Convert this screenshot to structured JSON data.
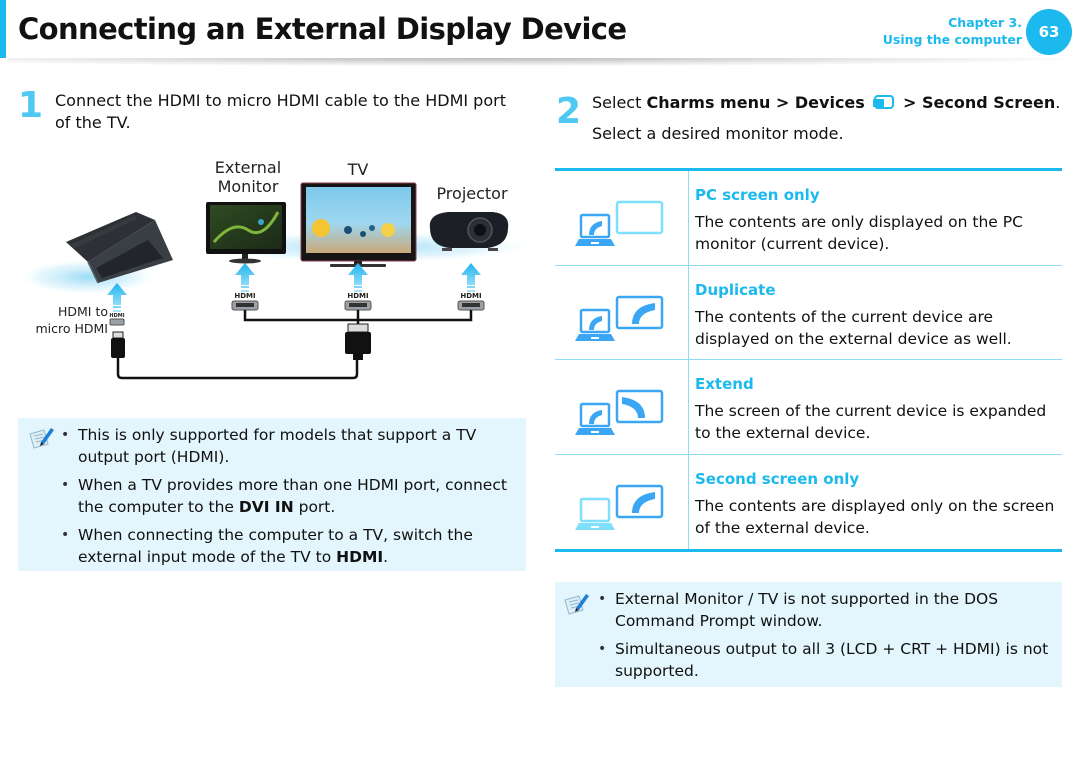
{
  "header": {
    "title": "Connecting an External Display Device",
    "chapter_line1": "Chapter 3.",
    "chapter_line2": "Using the computer",
    "page_number": "63",
    "accent_color": "#1bb9ee"
  },
  "step1": {
    "number": "1",
    "text": "Connect the HDMI to micro HDMI cable to the HDMI port of the TV.",
    "diagram": {
      "labels": {
        "external_monitor_line1": "External",
        "external_monitor_line2": "Monitor",
        "tv": "TV",
        "projector": "Projector",
        "cable_line1": "HDMI to",
        "cable_line2": "micro HDMI"
      },
      "port_label": "HDMI"
    },
    "notes": [
      {
        "text": "This is only supported for models that support a TV output port (HDMI).",
        "bold": ""
      },
      {
        "pre": "When a TV provides more than one HDMI port, connect the computer to the ",
        "bold": "DVI IN",
        "post": " port."
      },
      {
        "pre": "When connecting the computer to a TV, switch the external input mode of the TV to ",
        "bold": "HDMI",
        "post": "."
      }
    ]
  },
  "step2": {
    "number": "2",
    "line1": {
      "pre": "Select ",
      "bold1": "Charms menu > Devices",
      "icon": "devices-icon",
      "bold2": "> Second Screen",
      "post": "."
    },
    "line2": "Select a desired monitor mode.",
    "modes": [
      {
        "title": "PC screen only",
        "description": "The contents are only displayed on the PC monitor (current device).",
        "icon": "pc-screen-only-icon"
      },
      {
        "title": "Duplicate",
        "description": "The contents of the current device are displayed on the external device as well.",
        "icon": "duplicate-icon"
      },
      {
        "title": "Extend",
        "description": "The screen of the current device is expanded to the external device.",
        "icon": "extend-icon"
      },
      {
        "title": "Second screen only",
        "description": "The contents are displayed only on the screen of the external device.",
        "icon": "second-screen-only-icon"
      }
    ],
    "notes": [
      {
        "text": "External Monitor / TV is not supported in the DOS Command Prompt window."
      },
      {
        "text": "Simultaneous output to all 3 (LCD + CRT + HDMI) is not supported."
      }
    ]
  }
}
